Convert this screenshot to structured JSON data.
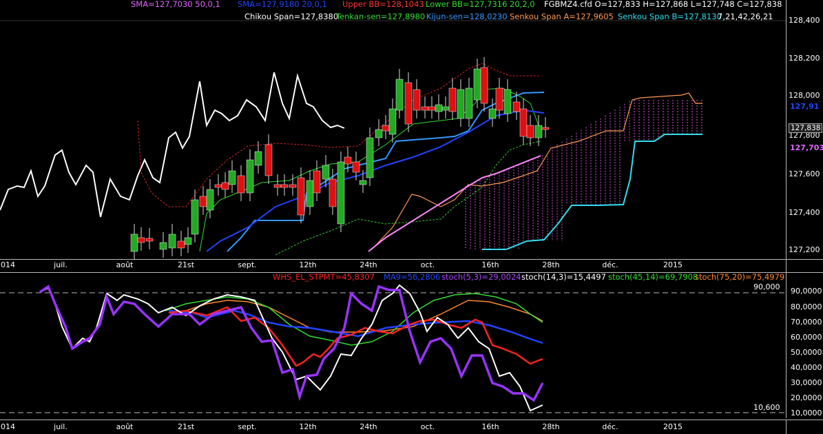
{
  "main_legend": {
    "line1": [
      {
        "text": "SMA=127,7030  50,0,1",
        "color": "#e066ff"
      },
      {
        "text": "SMA=127,9180  20,0,1",
        "color": "#2244ff"
      },
      {
        "text": "Upper BB=128,1043",
        "color": "#ff3333"
      },
      {
        "text": "Lower BB=127,7316  20,2,0",
        "color": "#33dd33"
      },
      {
        "text": "FGBMZ4.cfd O=127,833 H=127,868 L=127,748 C=127,838",
        "color": "#ffffff"
      }
    ],
    "line2": [
      {
        "text": "Chikou Span=127,8380",
        "color": "#ffffff"
      },
      {
        "text": "Tenkan-sen=127,8980",
        "color": "#33dd33"
      },
      {
        "text": "Kijun-sen=128,0230",
        "color": "#3399ff"
      },
      {
        "text": "Senkou Span A=127,9605",
        "color": "#ff9955"
      },
      {
        "text": "Senkou Span B=127,8130",
        "color": "#33ddee"
      },
      {
        "text": "7,21,42,26,21",
        "color": "#ffffff"
      }
    ]
  },
  "main_yaxis": [
    "128,400",
    "128,200",
    "128,000",
    "127,800",
    "127,600",
    "127,400",
    "127,200"
  ],
  "main_tags": {
    "blue": "127,91",
    "last": "127,838",
    "pink": "127,703"
  },
  "time_labels": [
    "2014",
    "juil.",
    "août",
    "21st",
    "sept.",
    "12th",
    "24th",
    "oct.",
    "16th",
    "28th",
    "déc.",
    "2015"
  ],
  "sub_legend": [
    {
      "text": "WHS_EL_STPMT=45,8307",
      "color": "#ff2222"
    },
    {
      "text": "MA9=56,2806",
      "color": "#2244ff"
    },
    {
      "text": "stoch(5,3)=29,0024",
      "color": "#aa44ff"
    },
    {
      "text": "stoch(14,3)=15,4497",
      "color": "#ffffff"
    },
    {
      "text": "stoch(45,14)=69,7908",
      "color": "#33dd33"
    },
    {
      "text": "stoch(75,20)=75,4979",
      "color": "#ff8833"
    }
  ],
  "sub_yaxis": [
    "90,0000",
    "80,0000",
    "70,0000",
    "60,0000",
    "50,0000",
    "40,0000",
    "30,0000",
    "20,0000",
    "10,0000"
  ],
  "sub_levels": {
    "upper": "90,000",
    "lower": "10,600"
  },
  "colors": {
    "background": "#000000",
    "bull": "#22aa22",
    "bear": "#dd1111",
    "chikou": "#ffffff",
    "tenkan": "#33dd33",
    "kijun": "#3399ff",
    "spanA": "#ff9955",
    "spanB": "#33ddee",
    "sma50": "#ff88ff",
    "sma20": "#2244ff",
    "bb_upper": "#cc2222",
    "bb_lower": "#33cc33"
  }
}
